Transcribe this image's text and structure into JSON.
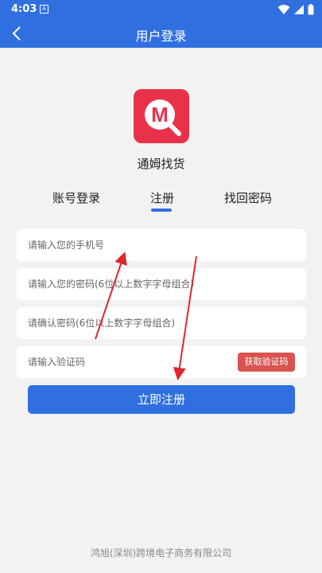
{
  "status_bar": {
    "time": "4:03",
    "notification_badge": "A"
  },
  "app_bar": {
    "title": "用户登录"
  },
  "brand": {
    "logo_letter": "M",
    "name": "通姆找货"
  },
  "tabs": [
    {
      "label": "账号登录",
      "active": false
    },
    {
      "label": "注册",
      "active": true
    },
    {
      "label": "找回密码",
      "active": false
    }
  ],
  "form": {
    "phone_placeholder": "请输入您的手机号",
    "password_placeholder": "请输入您的密码(6位以上数字字母组合)",
    "confirm_placeholder": "请确认密码(6位以上数字字母组合)",
    "code_placeholder": "请输入验证码",
    "get_code_label": "获取验证码",
    "submit_label": "立即注册"
  },
  "footer": {
    "company": "鸿旭(深圳)跨境电子商务有限公司"
  },
  "colors": {
    "primary": "#2f6fe0",
    "logo": "#e8324a",
    "code_button": "#d9534f",
    "annotation_arrow": "#e0262f"
  }
}
